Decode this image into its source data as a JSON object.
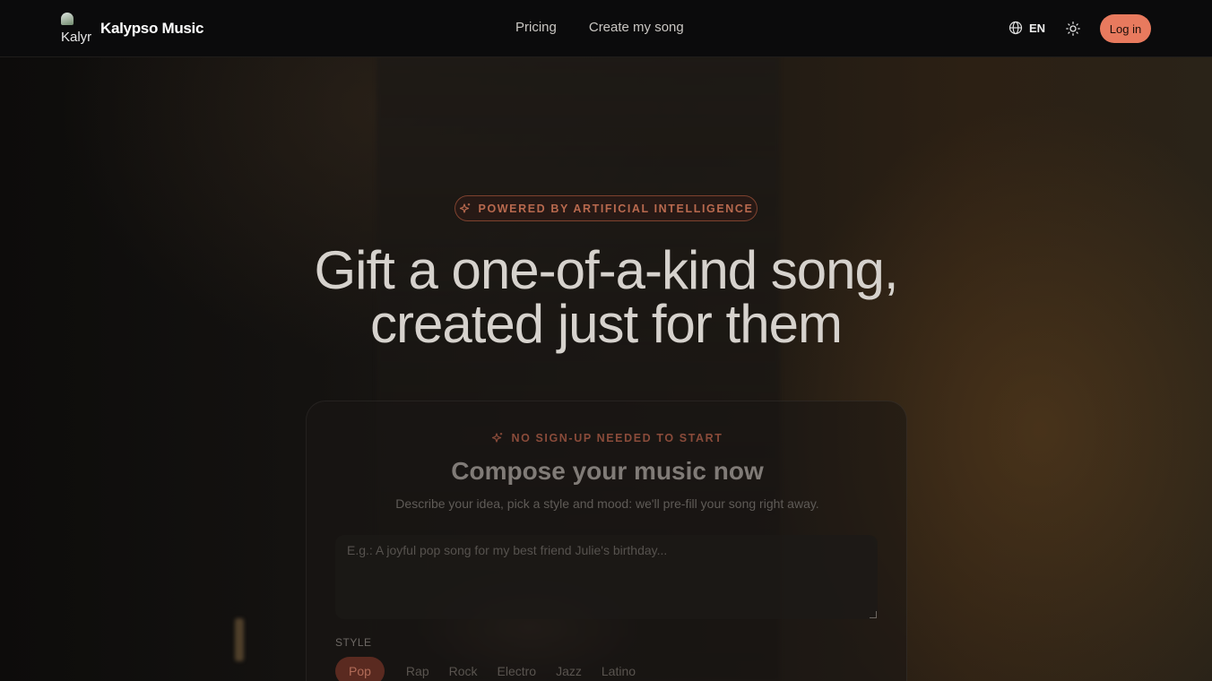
{
  "header": {
    "logo_alt": "Kalyr",
    "brand": "Kalypso Music",
    "nav": [
      {
        "label": "Pricing"
      },
      {
        "label": "Create my song"
      }
    ],
    "language": "EN",
    "login_label": "Log in",
    "login_color": "#e87a5e"
  },
  "hero": {
    "badge": "POWERED BY ARTIFICIAL INTELLIGENCE",
    "title_line1": "Gift a one-of-a-kind song,",
    "title_line2": "created just for them"
  },
  "composer": {
    "badge": "NO SIGN-UP NEEDED TO START",
    "title": "Compose your music now",
    "subtitle": "Describe your idea, pick a style and mood: we'll pre-fill your song right away.",
    "prompt_placeholder": "E.g.: A joyful pop song for my best friend Julie's birthday...",
    "style_label": "STYLE",
    "styles": [
      "Pop",
      "Rap",
      "Rock",
      "Electro",
      "Jazz",
      "Latino"
    ],
    "selected_style": "Pop"
  },
  "icons": {
    "sparkle": "sparkle-icon",
    "globe": "globe-icon",
    "theme": "sun-icon"
  }
}
